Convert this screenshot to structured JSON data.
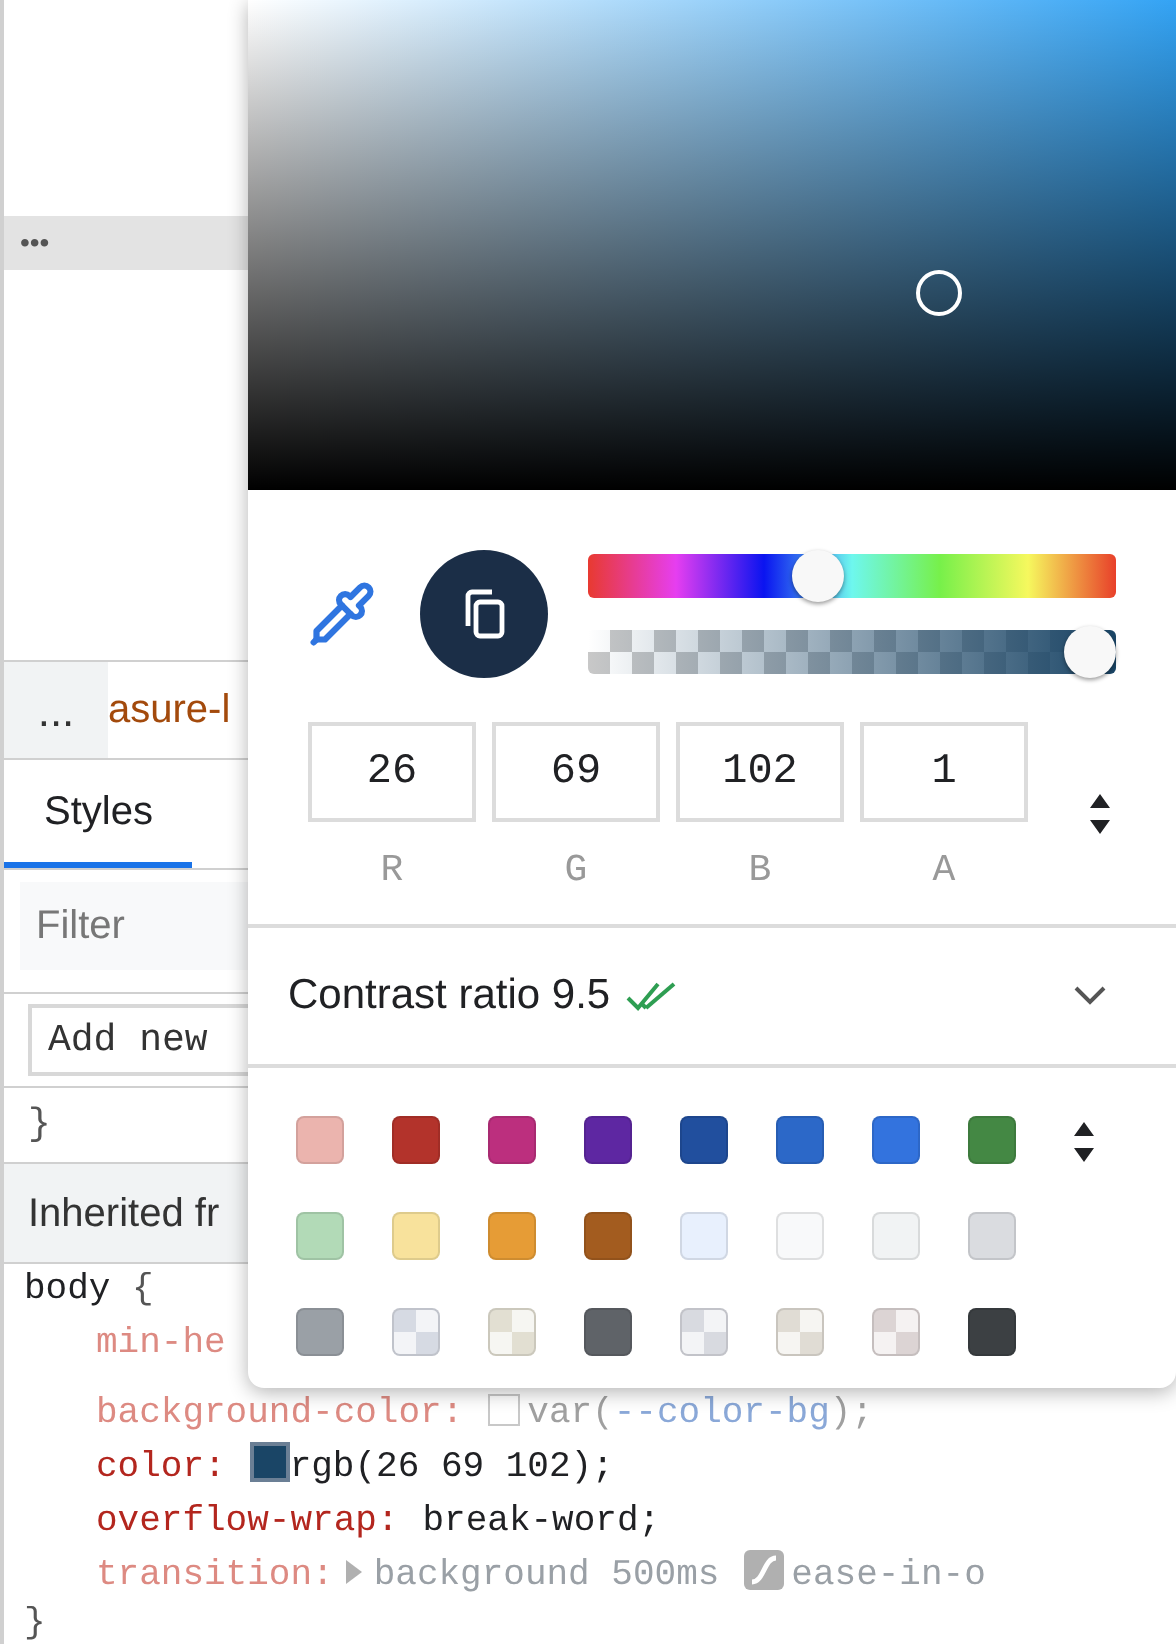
{
  "elements_panel": {
    "more_label": "•••"
  },
  "breadcrumb": {
    "more_label": "...",
    "crumb": "asure-l"
  },
  "tabs": [
    {
      "label": "Styles",
      "selected": true
    }
  ],
  "filter": {
    "placeholder": "Filter"
  },
  "add_rule": {
    "label": "Add new"
  },
  "closing_brace": "}",
  "inherited": {
    "label": "Inherited fr"
  },
  "rule": {
    "selector": "body",
    "open": "{",
    "close": "}",
    "declarations": [
      {
        "kind": "cut",
        "property": "min-he",
        "inactive": true
      },
      {
        "kind": "var",
        "property": "background-color",
        "colon": ":",
        "inactive": true,
        "var_open": "var(",
        "var_name": "--color-bg",
        "var_close": ");"
      },
      {
        "kind": "color",
        "property": "color",
        "colon": ":",
        "inactive": false,
        "value": "rgb(26 69 102);"
      },
      {
        "kind": "plain",
        "property": "overflow-wrap",
        "colon": ":",
        "inactive": false,
        "value": "break-word;"
      },
      {
        "kind": "transition",
        "property": "transition",
        "colon": ":",
        "inactive": true,
        "value": "background 500ms",
        "easing": "ease-in-o"
      }
    ]
  },
  "color_picker": {
    "hue": {
      "level": 0.43
    },
    "alpha": {
      "level": 1
    },
    "channels": [
      {
        "value": "26",
        "label": "R"
      },
      {
        "value": "69",
        "label": "G"
      },
      {
        "value": "102",
        "label": "B"
      },
      {
        "value": "1",
        "label": "A"
      }
    ],
    "contrast": {
      "label": "Contrast ratio 9.5",
      "passes": true,
      "expanded": false
    },
    "swatches": [
      {
        "kind": "solid",
        "color": "#ebb4ae"
      },
      {
        "kind": "solid",
        "color": "#b3332b"
      },
      {
        "kind": "solid",
        "color": "#bc2f7e"
      },
      {
        "kind": "solid",
        "color": "#5e27a2"
      },
      {
        "kind": "solid",
        "color": "#214f9e"
      },
      {
        "kind": "solid",
        "color": "#2c68c8"
      },
      {
        "kind": "solid",
        "color": "#3373de"
      },
      {
        "kind": "solid",
        "color": "#448844"
      },
      {
        "kind": "solid",
        "color": "#b2dab7"
      },
      {
        "kind": "solid",
        "color": "#f8e29c"
      },
      {
        "kind": "solid",
        "color": "#e69c36"
      },
      {
        "kind": "solid",
        "color": "#a35c1f"
      },
      {
        "kind": "solid",
        "color": "#e8f0fd"
      },
      {
        "kind": "solid",
        "color": "#f8f9fa"
      },
      {
        "kind": "solid",
        "color": "#f1f3f4"
      },
      {
        "kind": "solid",
        "color": "#dadce0"
      },
      {
        "kind": "solid",
        "color": "#9aa0a6"
      },
      {
        "kind": "translucent",
        "color": "#d6dae3"
      },
      {
        "kind": "translucent",
        "color": "#e2dfd2"
      },
      {
        "kind": "solid",
        "color": "#5f6368"
      },
      {
        "kind": "translucent",
        "color": "#d8dae0"
      },
      {
        "kind": "translucent",
        "color": "#e0dcd4"
      },
      {
        "kind": "translucent",
        "color": "#dcd4d4"
      },
      {
        "kind": "solid",
        "color": "#3c4043"
      }
    ]
  }
}
